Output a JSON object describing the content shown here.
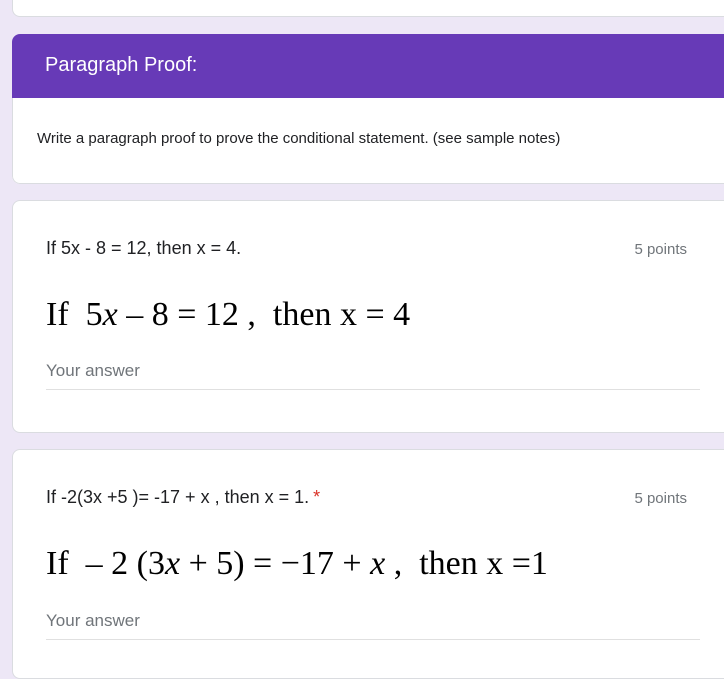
{
  "section": {
    "title": "Paragraph Proof:",
    "description": "Write a paragraph proof to prove the conditional statement.  (see sample notes)"
  },
  "questions": [
    {
      "title": "If 5x - 8 = 12, then x = 4.",
      "required": false,
      "points": "5 points",
      "image_math": [
        "If  5",
        "x",
        " – 8 = 12 ,  then x = 4"
      ],
      "answer_placeholder": "Your answer",
      "answer_value": ""
    },
    {
      "title": "If -2(3x +5 )= -17  + x , then x = 1.",
      "required": true,
      "required_marker": "*",
      "points": "5 points",
      "image_math": [
        "If  – 2 (3",
        "x",
        " + 5) = −17 + ",
        "x",
        " ,  then x =1"
      ],
      "answer_placeholder": "Your answer",
      "answer_value": ""
    }
  ]
}
